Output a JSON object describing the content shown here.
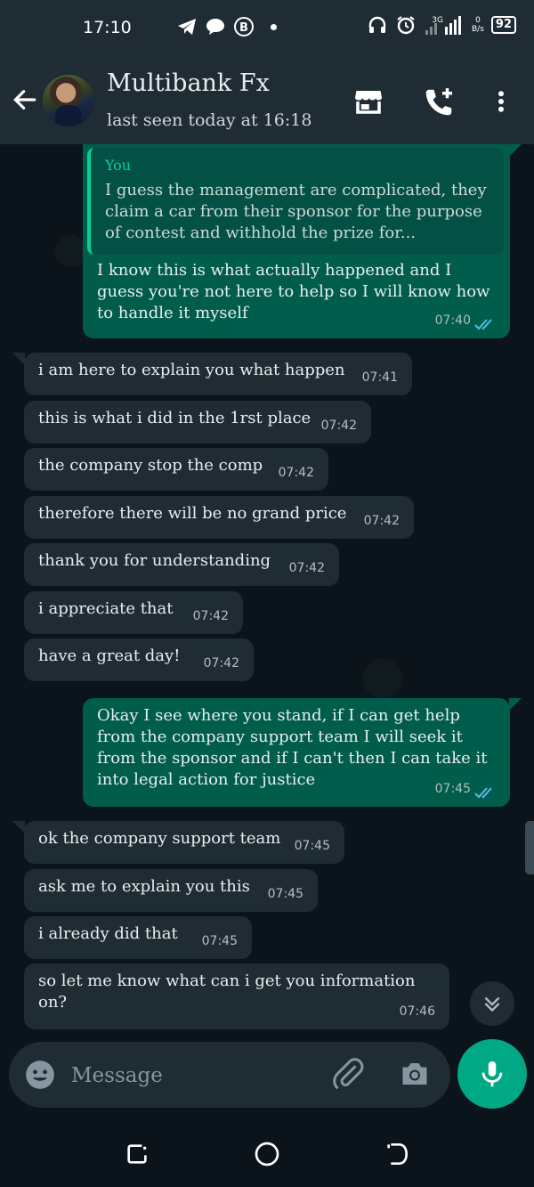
{
  "status_bar": {
    "time": "17:10",
    "net_type": "3G",
    "speed_value": "0",
    "speed_unit": "B/s",
    "battery": "92"
  },
  "header": {
    "contact_name": "Multibank Fx",
    "last_seen": "last seen today at 16:18"
  },
  "quote": {
    "author": "You",
    "text": "I guess the management are complicated, they claim a car from their sponsor for the purpose of contest and withhold the prize for..."
  },
  "messages": [
    {
      "direction": "out",
      "lines": [
        "I know this is what actually happened and I",
        "guess you're not here to help so I will know how",
        "to handle it myself"
      ],
      "time": "07:40"
    },
    {
      "direction": "in",
      "text": "i am here to explain you what happen",
      "time": "07:41"
    },
    {
      "direction": "in",
      "text": "this is what i did in the 1rst place",
      "time": "07:42"
    },
    {
      "direction": "in",
      "text": "the company stop the comp",
      "time": "07:42"
    },
    {
      "direction": "in",
      "text": "therefore there will be no grand price",
      "time": "07:42"
    },
    {
      "direction": "in",
      "text": "thank you for understanding",
      "time": "07:42"
    },
    {
      "direction": "in",
      "text": "i appreciate that",
      "time": "07:42"
    },
    {
      "direction": "in",
      "text": "have a great day!",
      "time": "07:42"
    },
    {
      "direction": "out",
      "lines": [
        "Okay I see where you stand, if I can get help",
        "from the company support team I will seek it",
        "from the sponsor and if I can't then I can take it",
        "into legal action for justice"
      ],
      "time": "07:45"
    },
    {
      "direction": "in",
      "text": "ok the company support team",
      "time": "07:45"
    },
    {
      "direction": "in",
      "text": "ask me to explain you this",
      "time": "07:45"
    },
    {
      "direction": "in",
      "text": "i already did that",
      "time": "07:45"
    },
    {
      "direction": "in",
      "lines": [
        "so let me know what can i get you information",
        "on?"
      ],
      "time": "07:46"
    }
  ],
  "composer": {
    "placeholder": "Message"
  },
  "colors": {
    "background": "#0b141a",
    "header": "#1f2c34",
    "incoming_bubble": "#202c33",
    "outgoing_bubble": "#005c4b",
    "accent": "#00a884",
    "read_ticks": "#53bdeb"
  },
  "icons": [
    "telegram-icon",
    "chat-bubble-icon",
    "b-icon",
    "headphones-icon",
    "alarm-icon",
    "signal-icon",
    "back-arrow-icon",
    "store-icon",
    "add-call-icon",
    "more-vert-icon",
    "double-check-icon",
    "chevrons-down-icon",
    "emoji-icon",
    "attach-icon",
    "camera-icon",
    "mic-icon",
    "recents-icon",
    "home-icon",
    "back-nav-icon"
  ]
}
